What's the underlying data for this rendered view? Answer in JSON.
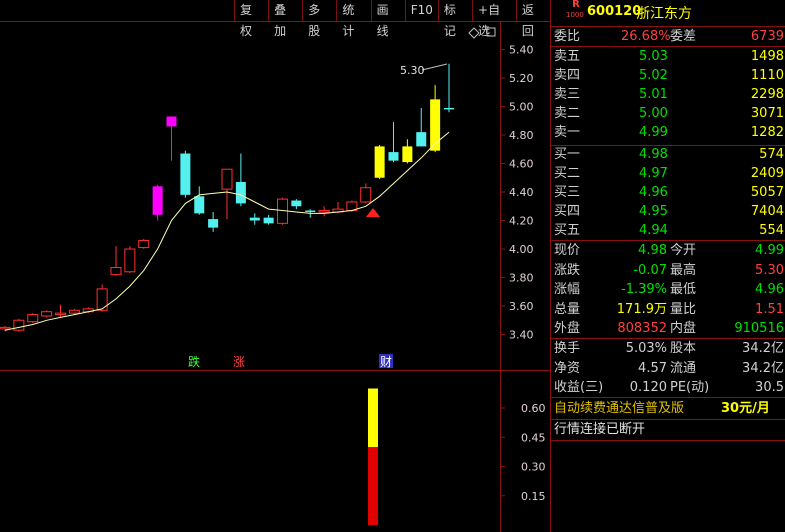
{
  "toolbar": [
    "复权",
    "叠加",
    "多股",
    "统计",
    "画线",
    "F10",
    "标记",
    "+自选",
    "返回"
  ],
  "header": {
    "code": "600120",
    "name": "浙江东方",
    "badge_top": "R",
    "badge_bottom": "1000"
  },
  "weibi": {
    "label1": "委比",
    "value1": "26.68%",
    "label2": "委差",
    "value2": "6739"
  },
  "asks": [
    {
      "label": "卖五",
      "price": "5.03",
      "vol": "1498"
    },
    {
      "label": "卖四",
      "price": "5.02",
      "vol": "1110"
    },
    {
      "label": "卖三",
      "price": "5.01",
      "vol": "2298"
    },
    {
      "label": "卖二",
      "price": "5.00",
      "vol": "3071"
    },
    {
      "label": "卖一",
      "price": "4.99",
      "vol": "1282"
    }
  ],
  "bids": [
    {
      "label": "买一",
      "price": "4.98",
      "vol": "574"
    },
    {
      "label": "买二",
      "price": "4.97",
      "vol": "2409"
    },
    {
      "label": "买三",
      "price": "4.96",
      "vol": "5057"
    },
    {
      "label": "买四",
      "price": "4.95",
      "vol": "7404"
    },
    {
      "label": "买五",
      "price": "4.94",
      "vol": "554"
    }
  ],
  "quote": [
    {
      "l1": "现价",
      "v1": "4.98",
      "l2": "今开",
      "v2": "4.99",
      "c1": "#00e000",
      "c2": "#00e000"
    },
    {
      "l1": "涨跌",
      "v1": "-0.07",
      "l2": "最高",
      "v2": "5.30",
      "c1": "#00e000",
      "c2": "#ff4040"
    },
    {
      "l1": "涨幅",
      "v1": "-1.39%",
      "l2": "最低",
      "v2": "4.96",
      "c1": "#00e000",
      "c2": "#00e000"
    },
    {
      "l1": "总量",
      "v1": "171.9万",
      "l2": "量比",
      "v2": "1.51",
      "c1": "#ffff00",
      "c2": "#ff4040"
    },
    {
      "l1": "外盘",
      "v1": "808352",
      "l2": "内盘",
      "v2": "910516",
      "c1": "#ff4040",
      "c2": "#00e000"
    }
  ],
  "fund": [
    {
      "l1": "换手",
      "v1": "5.03%",
      "l2": "股本",
      "v2": "34.2亿"
    },
    {
      "l1": "净资",
      "v1": "4.57",
      "l2": "流通",
      "v2": "34.2亿"
    },
    {
      "l1": "收益(三)",
      "v1": "0.120",
      "l2": "PE(动)",
      "v2": "30.5"
    }
  ],
  "notice": {
    "text": "自动续费通达信普及版",
    "price": "30元/月"
  },
  "status": "行情连接已断开",
  "chart_data": [
    {
      "type": "candlestick",
      "yticks": [
        "5.40",
        "5.20",
        "5.00",
        "4.80",
        "4.60",
        "4.40",
        "4.20",
        "4.00",
        "3.80",
        "3.60",
        "3.40"
      ],
      "ylim": [
        3.33,
        5.52
      ],
      "high_label": "5.30",
      "markers": [
        "跌",
        "涨",
        "财"
      ],
      "candles": [
        {
          "o": 3.44,
          "c": 3.45,
          "h": 3.46,
          "l": 3.42
        },
        {
          "o": 3.43,
          "c": 3.5,
          "h": 3.51,
          "l": 3.42
        },
        {
          "o": 3.49,
          "c": 3.54,
          "h": 3.55,
          "l": 3.48
        },
        {
          "o": 3.53,
          "c": 3.56,
          "h": 3.57,
          "l": 3.52
        },
        {
          "o": 3.55,
          "c": 3.55,
          "h": 3.61,
          "l": 3.52
        },
        {
          "o": 3.55,
          "c": 3.57,
          "h": 3.58,
          "l": 3.54
        },
        {
          "o": 3.56,
          "c": 3.58,
          "h": 3.59,
          "l": 3.55
        },
        {
          "o": 3.57,
          "c": 3.72,
          "h": 3.75,
          "l": 3.56
        },
        {
          "o": 3.82,
          "c": 3.87,
          "h": 4.02,
          "l": 3.81
        },
        {
          "o": 3.84,
          "c": 4.0,
          "h": 4.02,
          "l": 3.83
        },
        {
          "o": 4.01,
          "c": 4.06,
          "h": 4.07,
          "l": 4.0
        },
        {
          "o": 4.24,
          "c": 4.44,
          "h": 4.45,
          "l": 4.2
        },
        {
          "o": 4.86,
          "c": 4.93,
          "h": 4.93,
          "l": 4.62
        },
        {
          "o": 4.67,
          "c": 4.38,
          "h": 4.69,
          "l": 4.36
        },
        {
          "o": 4.37,
          "c": 4.25,
          "h": 4.44,
          "l": 4.24
        },
        {
          "o": 4.21,
          "c": 4.15,
          "h": 4.26,
          "l": 4.12
        },
        {
          "o": 4.42,
          "c": 4.56,
          "h": 4.56,
          "l": 4.21
        },
        {
          "o": 4.47,
          "c": 4.32,
          "h": 4.67,
          "l": 4.3
        },
        {
          "o": 4.22,
          "c": 4.2,
          "h": 4.25,
          "l": 4.17
        },
        {
          "o": 4.22,
          "c": 4.18,
          "h": 4.24,
          "l": 4.17
        },
        {
          "o": 4.18,
          "c": 4.35,
          "h": 4.36,
          "l": 4.17
        },
        {
          "o": 4.34,
          "c": 4.3,
          "h": 4.35,
          "l": 4.28
        },
        {
          "o": 4.27,
          "c": 4.26,
          "h": 4.28,
          "l": 4.22
        },
        {
          "o": 4.27,
          "c": 4.27,
          "h": 4.3,
          "l": 4.23
        },
        {
          "o": 4.26,
          "c": 4.28,
          "h": 4.33,
          "l": 4.25
        },
        {
          "o": 4.27,
          "c": 4.33,
          "h": 4.34,
          "l": 4.26
        },
        {
          "o": 4.33,
          "c": 4.43,
          "h": 4.46,
          "l": 4.32
        },
        {
          "o": 4.5,
          "c": 4.72,
          "h": 4.73,
          "l": 4.49
        },
        {
          "o": 4.68,
          "c": 4.62,
          "h": 4.89,
          "l": 4.61
        },
        {
          "o": 4.61,
          "c": 4.72,
          "h": 4.77,
          "l": 4.6
        },
        {
          "o": 4.82,
          "c": 4.72,
          "h": 4.99,
          "l": 4.72
        },
        {
          "o": 4.69,
          "c": 5.05,
          "h": 5.15,
          "l": 4.68
        },
        {
          "o": 4.99,
          "c": 4.98,
          "h": 5.3,
          "l": 4.96
        }
      ],
      "ma": [
        3.43,
        3.45,
        3.47,
        3.5,
        3.52,
        3.54,
        3.56,
        3.58,
        3.65,
        3.74,
        3.85,
        4.0,
        4.2,
        4.32,
        4.38,
        4.39,
        4.4,
        4.38,
        4.33,
        4.28,
        4.27,
        4.26,
        4.25,
        4.25,
        4.26,
        4.27,
        4.3,
        4.37,
        4.46,
        4.55,
        4.64,
        4.74,
        4.82
      ]
    },
    {
      "type": "bar",
      "yticks": [
        "0.60",
        "0.45",
        "0.30",
        "0.15"
      ],
      "ylim": [
        0,
        0.74
      ],
      "segments": [
        {
          "value": 0.4,
          "color": "#e00000"
        },
        {
          "value": 0.3,
          "color": "#ffff00"
        }
      ]
    }
  ]
}
